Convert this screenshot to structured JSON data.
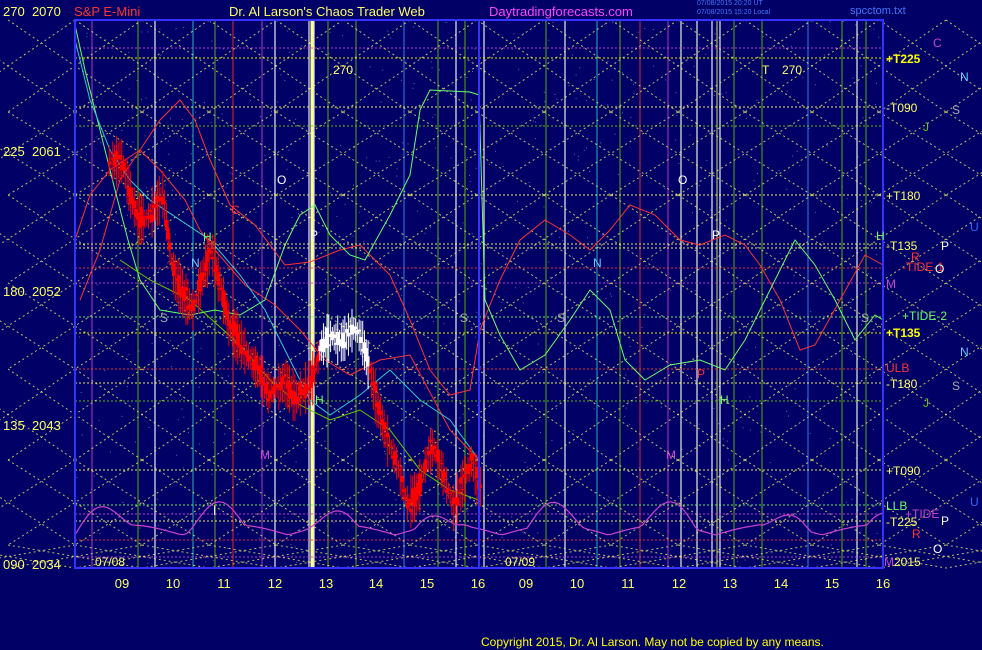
{
  "header": {
    "title_left": "S&P E-Mini",
    "title_center": "Dr. Al Larson's Chaos Trader Web",
    "site": "Daytradingforecasts.com",
    "stamp1": "07/08/2015 20:20 UT",
    "stamp2": "07/08/2015 15:20 Local",
    "file": "spcctom.txt"
  },
  "y_labels": [
    {
      "angle": "270",
      "price": "2070"
    },
    {
      "angle": "225",
      "price": "2061"
    },
    {
      "angle": "180",
      "price": "2052"
    },
    {
      "angle": "135",
      "price": "2043"
    },
    {
      "angle": "090",
      "price": "2034"
    }
  ],
  "x_labels": [
    "09",
    "10",
    "11",
    "12",
    "13",
    "14",
    "15",
    "16",
    "09",
    "10",
    "11",
    "12",
    "13",
    "14",
    "15",
    "16"
  ],
  "date_labels": [
    "07/08",
    "07/09"
  ],
  "right_labels": [
    {
      "text": "C",
      "color": "#cc44cc"
    },
    {
      "text": "+T225",
      "color": "#ffff00"
    },
    {
      "text": "N",
      "color": "#66ccff"
    },
    {
      "text": "-T090",
      "color": "#ffff66"
    },
    {
      "text": "S",
      "color": "#aaaaaa"
    },
    {
      "text": "J",
      "color": "#66cc00"
    },
    {
      "text": "+T180",
      "color": "#ffff66"
    },
    {
      "text": "U",
      "color": "#3366ff"
    },
    {
      "text": "-T135",
      "color": "#ffff66"
    },
    {
      "text": "P",
      "color": "#ffffff"
    },
    {
      "text": "-TIDE-1",
      "color": "#ff3333"
    },
    {
      "text": "O",
      "color": "#ffffff"
    },
    {
      "text": "M",
      "color": "#cc44cc"
    },
    {
      "text": "+TIDE-2",
      "color": "#66ff66"
    },
    {
      "text": "+T135",
      "color": "#ffff00"
    },
    {
      "text": "N",
      "color": "#66ccff"
    },
    {
      "text": "ULB",
      "color": "#ff3333"
    },
    {
      "text": "-T180",
      "color": "#ffff66"
    },
    {
      "text": "S",
      "color": "#aaaaaa"
    },
    {
      "text": "J",
      "color": "#66cc00"
    },
    {
      "text": "+T090",
      "color": "#ffff66"
    },
    {
      "text": "LLB",
      "color": "#66ff66"
    },
    {
      "text": "+TIDE",
      "color": "#cc44cc"
    },
    {
      "text": "U",
      "color": "#3366ff"
    },
    {
      "text": "-T225",
      "color": "#ffff66"
    },
    {
      "text": "P",
      "color": "#ffffff"
    },
    {
      "text": "R",
      "color": "#ff3333"
    },
    {
      "text": "O",
      "color": "#ffffff"
    },
    {
      "text": "M",
      "color": "#cc44cc"
    },
    {
      "text": "2015",
      "color": "#ffff66"
    }
  ],
  "chart_marks": [
    {
      "text": "270",
      "color": "#ffff66"
    },
    {
      "text": "270",
      "color": "#ffff66"
    },
    {
      "text": "T",
      "color": "#ffff66"
    },
    {
      "text": "O",
      "color": "#ffffff"
    },
    {
      "text": "O",
      "color": "#ffffff"
    },
    {
      "text": "P",
      "color": "#ffffff"
    },
    {
      "text": "P",
      "color": "#ffffff"
    },
    {
      "text": "N",
      "color": "#66ccff"
    },
    {
      "text": "N",
      "color": "#66ccff"
    },
    {
      "text": "S",
      "color": "#aaaaaa"
    },
    {
      "text": "S",
      "color": "#aaaaaa"
    },
    {
      "text": "S",
      "color": "#aaaaaa"
    },
    {
      "text": "S",
      "color": "#aaaaaa"
    },
    {
      "text": "H",
      "color": "#66ff66"
    },
    {
      "text": "H",
      "color": "#66ff66"
    },
    {
      "text": "H",
      "color": "#66ff66"
    },
    {
      "text": "H",
      "color": "#66ff66"
    },
    {
      "text": "M",
      "color": "#cc44cc"
    },
    {
      "text": "M",
      "color": "#cc44cc"
    },
    {
      "text": "R",
      "color": "#ff3333"
    },
    {
      "text": "P",
      "color": "#ff3333"
    },
    {
      "text": "C",
      "color": "#ff3333"
    },
    {
      "text": "I",
      "color": "#ffffff"
    }
  ],
  "copyright": "Copyright 2015, Dr. Al Larson. May not be copied by any means.",
  "colors": {
    "background": "#000066",
    "frame": "#3333ff",
    "candle_up": "#ffffff",
    "candle_down": "#ff0000",
    "tide_red": "#ff3333",
    "tide_green": "#66ff66",
    "tide_cyan": "#33cccc",
    "bottom_magenta": "#cc44cc",
    "grid_yellow": "#ffff66"
  },
  "chart_data": {
    "type": "candlestick",
    "title": "S&P E-Mini",
    "ylim": [
      2034,
      2070
    ],
    "yticks": [
      2034,
      2043,
      2052,
      2061,
      2070
    ],
    "x_hours": [
      "09",
      "10",
      "11",
      "12",
      "13",
      "14",
      "15",
      "16"
    ],
    "days": [
      "07/08",
      "07/09"
    ],
    "price_path": [
      [
        9.0,
        2060.8
      ],
      [
        9.1,
        2059.5
      ],
      [
        9.2,
        2058.2
      ],
      [
        9.3,
        2057.1
      ],
      [
        9.45,
        2056.9
      ],
      [
        9.6,
        2057.5
      ],
      [
        9.8,
        2058.6
      ],
      [
        9.9,
        2056.0
      ],
      [
        10.0,
        2053.5
      ],
      [
        10.2,
        2052.0
      ],
      [
        10.4,
        2051.0
      ],
      [
        10.6,
        2053.5
      ],
      [
        10.75,
        2055.0
      ],
      [
        10.9,
        2053.0
      ],
      [
        11.1,
        2050.0
      ],
      [
        11.3,
        2049.0
      ],
      [
        11.5,
        2047.8
      ],
      [
        11.7,
        2046.9
      ],
      [
        11.85,
        2045.6
      ],
      [
        12.0,
        2045.8
      ],
      [
        12.2,
        2046.3
      ],
      [
        12.4,
        2045.2
      ],
      [
        12.6,
        2045.9
      ],
      [
        12.75,
        2046.6
      ],
      [
        12.9,
        2048.6
      ],
      [
        13.1,
        2049.3
      ],
      [
        13.3,
        2048.9
      ],
      [
        13.55,
        2049.8
      ],
      [
        13.7,
        2049.1
      ],
      [
        13.85,
        2047.1
      ],
      [
        14.0,
        2044.8
      ],
      [
        14.2,
        2042.5
      ],
      [
        14.4,
        2040.8
      ],
      [
        14.6,
        2038.2
      ],
      [
        14.8,
        2039.0
      ],
      [
        15.0,
        2041.5
      ],
      [
        15.1,
        2042.0
      ],
      [
        15.3,
        2040.2
      ],
      [
        15.5,
        2038.0
      ],
      [
        15.7,
        2039.8
      ],
      [
        15.85,
        2041.1
      ],
      [
        16.0,
        2039.4
      ]
    ],
    "series": [
      {
        "name": "TIDE-1",
        "color": "#ff3333"
      },
      {
        "name": "TIDE-2",
        "color": "#66ff66"
      },
      {
        "name": "TIDE",
        "color": "#cc44cc"
      }
    ]
  }
}
